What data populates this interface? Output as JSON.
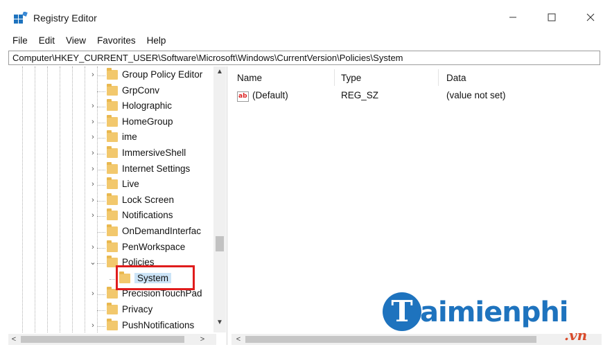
{
  "window": {
    "title": "Registry Editor",
    "icon": "registry-editor-icon",
    "controls": [
      "minimize-icon",
      "maximize-icon",
      "close-icon"
    ]
  },
  "menu": [
    "File",
    "Edit",
    "View",
    "Favorites",
    "Help"
  ],
  "address": "Computer\\HKEY_CURRENT_USER\\Software\\Microsoft\\Windows\\CurrentVersion\\Policies\\System",
  "tree": {
    "items": [
      {
        "label": "Group Policy Editor",
        "expandable": true
      },
      {
        "label": "GrpConv",
        "expandable": false
      },
      {
        "label": "Holographic",
        "expandable": true
      },
      {
        "label": "HomeGroup",
        "expandable": true
      },
      {
        "label": "ime",
        "expandable": true
      },
      {
        "label": "ImmersiveShell",
        "expandable": true
      },
      {
        "label": "Internet Settings",
        "expandable": true
      },
      {
        "label": "Live",
        "expandable": true
      },
      {
        "label": "Lock Screen",
        "expandable": true
      },
      {
        "label": "Notifications",
        "expandable": true
      },
      {
        "label": "OnDemandInterfac",
        "expandable": false
      },
      {
        "label": "PenWorkspace",
        "expandable": true
      },
      {
        "label": "Policies",
        "expandable": true,
        "expanded": true
      },
      {
        "label": "System",
        "expandable": false,
        "selected": true
      },
      {
        "label": "PrecisionTouchPad",
        "expandable": true
      },
      {
        "label": "Privacy",
        "expandable": false
      },
      {
        "label": "PushNotifications",
        "expandable": true
      }
    ]
  },
  "list": {
    "columns": [
      "Name",
      "Type",
      "Data"
    ],
    "rows": [
      {
        "name": "(Default)",
        "type": "REG_SZ",
        "data": "(value not set)",
        "icon": "string-value-icon"
      }
    ]
  },
  "watermark": {
    "brand": "aimienphi",
    "initial": "T",
    "suffix": ".vn"
  },
  "colors": {
    "highlight": "#e01c1c",
    "selection": "#cce4f7",
    "folder": "#f2c86d",
    "watermark": "#1e73be"
  }
}
